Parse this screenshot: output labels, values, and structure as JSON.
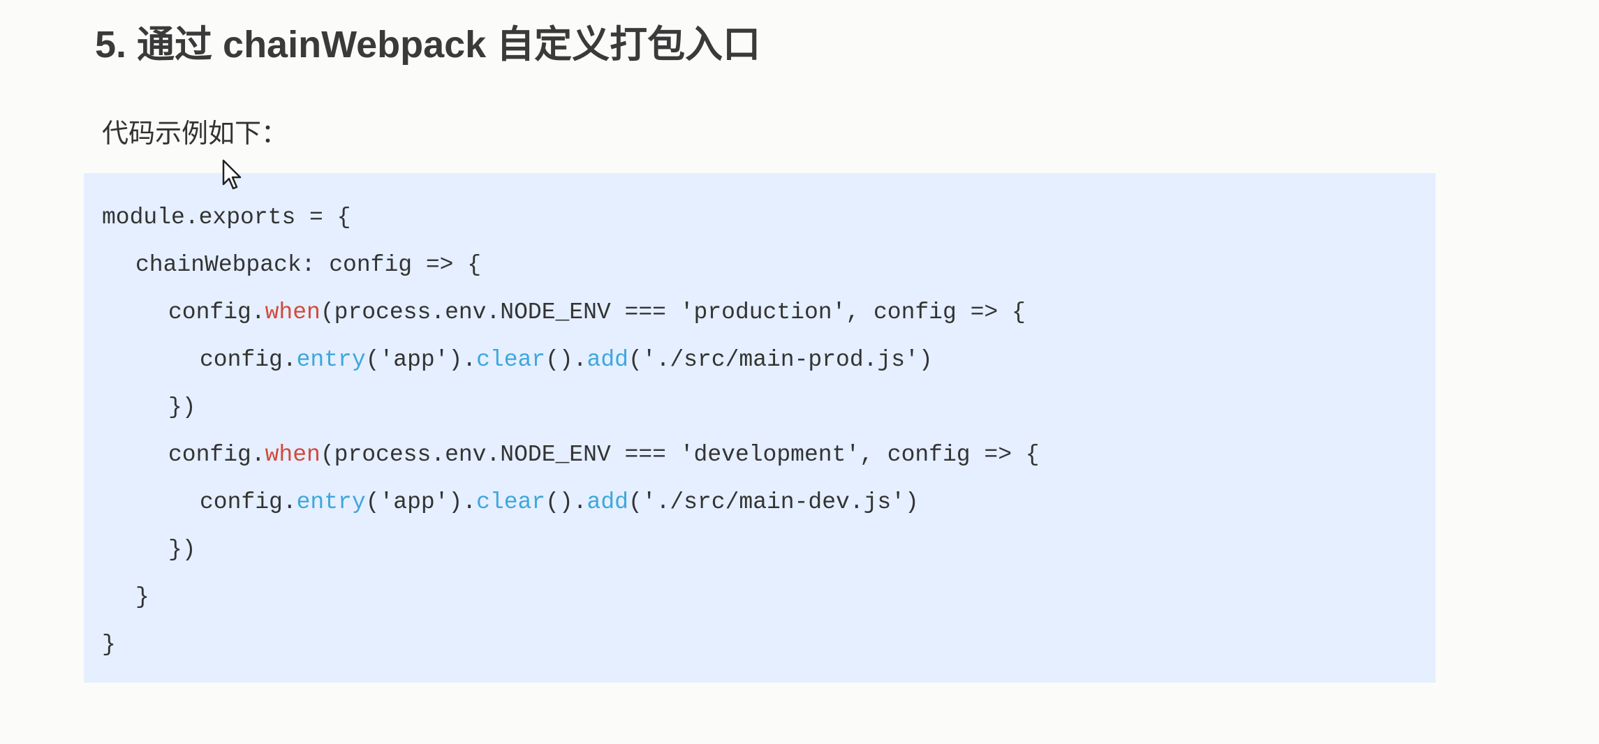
{
  "heading": {
    "title": "5. 通过 chainWebpack 自定义打包入口"
  },
  "intro": {
    "text": "代码示例如下："
  },
  "code": {
    "lines": [
      [
        {
          "t": "module.exports = {",
          "c": "plain"
        }
      ],
      [
        {
          "t": "chainWebpack: config => {",
          "c": "plain"
        }
      ],
      [
        {
          "t": "config.",
          "c": "plain"
        },
        {
          "t": "when",
          "c": "red"
        },
        {
          "t": "(process.env.NODE_ENV === 'production', config => {",
          "c": "plain"
        }
      ],
      [
        {
          "t": "config.",
          "c": "plain"
        },
        {
          "t": "entry",
          "c": "blue"
        },
        {
          "t": "('app').",
          "c": "plain"
        },
        {
          "t": "clear",
          "c": "blue"
        },
        {
          "t": "().",
          "c": "plain"
        },
        {
          "t": "add",
          "c": "blue"
        },
        {
          "t": "('./src/main-prod.js')",
          "c": "plain"
        }
      ],
      [
        {
          "t": "})",
          "c": "plain"
        }
      ],
      [
        {
          "t": "config.",
          "c": "plain"
        },
        {
          "t": "when",
          "c": "red"
        },
        {
          "t": "(process.env.NODE_ENV === 'development', config => {",
          "c": "plain"
        }
      ],
      [
        {
          "t": "config.",
          "c": "plain"
        },
        {
          "t": "entry",
          "c": "blue"
        },
        {
          "t": "('app').",
          "c": "plain"
        },
        {
          "t": "clear",
          "c": "blue"
        },
        {
          "t": "().",
          "c": "plain"
        },
        {
          "t": "add",
          "c": "blue"
        },
        {
          "t": "('./src/main-dev.js')",
          "c": "plain"
        }
      ],
      [
        {
          "t": "})",
          "c": "plain"
        }
      ],
      [
        {
          "t": "}",
          "c": "plain"
        }
      ],
      [
        {
          "t": "}",
          "c": "plain"
        }
      ]
    ]
  },
  "colors": {
    "code_background": "#e5efff",
    "keyword_red": "#d24a3a",
    "method_blue": "#3ea7dc"
  },
  "icons": {
    "cursor": "mouse-pointer-icon"
  }
}
